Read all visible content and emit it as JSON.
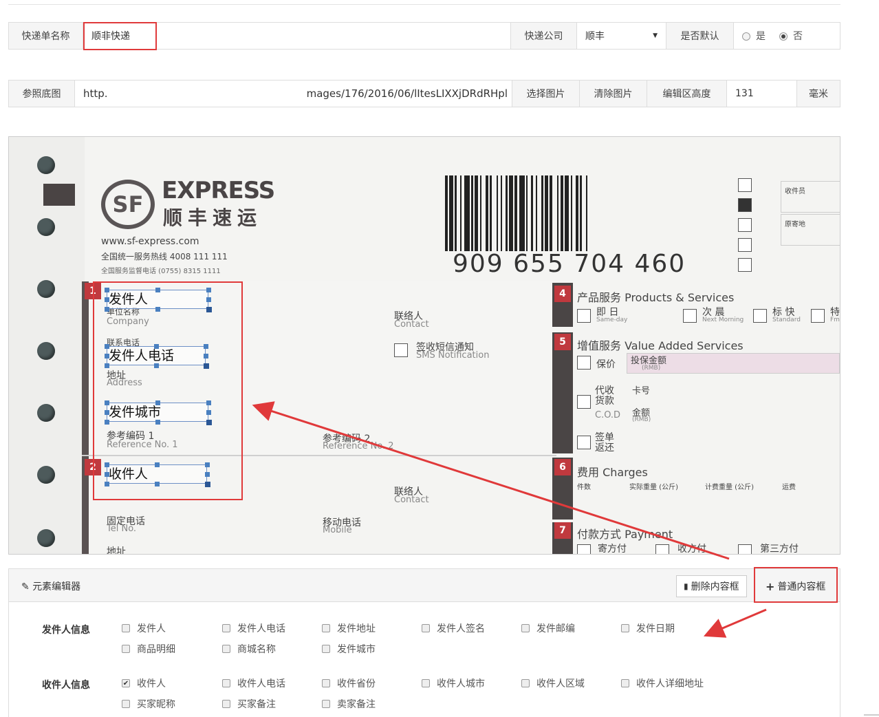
{
  "form": {
    "name_label": "快递单名称",
    "name_value": "顺非快递",
    "company_label": "快递公司",
    "company_value": "顺丰",
    "default_label": "是否默认",
    "default_yes": "是",
    "default_no": "否",
    "default_selected": "否",
    "image_label": "参照底图",
    "image_url_start": "http.",
    "image_url_end": "mages/176/2016/06/lItesLIXXjDRdRHpl",
    "choose_image": "选择图片",
    "clear_image": "清除图片",
    "height_label": "编辑区高度",
    "height_value": "131",
    "height_unit": "毫米"
  },
  "waybill": {
    "logo_mark": "SF",
    "logo_en": "EXPRESS",
    "logo_cn": "顺丰速运",
    "website": "www.sf-express.com",
    "hotline": "全国统一服务热线  4008 111 111",
    "supervise": "全国服务监督电话 (0755) 8315 1111",
    "tracking_number": "909  655  704  460",
    "receiver_staff": "收件员",
    "origin": "原寄地",
    "s1_num": "1",
    "company_cn": "单位名称",
    "company_en": "Company",
    "contact_cn": "联络人",
    "contact_en": "Contact",
    "phone_cn": "联系电话",
    "sms_cn": "签收短信通知",
    "sms_en": "SMS Notification",
    "address_cn": "地址",
    "address_en": "Address",
    "ref1_cn": "参考编码 1",
    "ref1_en": "Reference No. 1",
    "ref2_cn": "参考编码 2",
    "ref2_en": "Reference No. 2",
    "s2_num": "2",
    "tel_cn": "固定电话",
    "tel_en": "Tel No.",
    "mobile_cn": "移动电话",
    "mobile_en": "Mobile",
    "s4_num": "4",
    "products": "产品服务  Products & Services",
    "sameday_cn": "即 日",
    "sameday_en": "Same-day",
    "nextmorning_cn": "次 晨",
    "nextmorning_en": "Next Morning",
    "standard_cn": "标 快",
    "standard_en": "Standard",
    "special_cn": "特",
    "special_en": "Fm",
    "s5_num": "5",
    "value_added": "增值服务  Value Added Services",
    "insured": "保价",
    "insured_amount": "投保金额",
    "rmb": "(RMB)",
    "cod_cn": "代收\n货款",
    "cod_en": "C.O.D",
    "card_no": "卡号",
    "amount": "金额",
    "sign_return": "签单\n返还",
    "s6_num": "6",
    "charges": "费用  Charges",
    "pieces": "件数",
    "actual_weight": "实际重量 (公斤)",
    "charged_weight": "计费重量 (公斤)",
    "freight": "运费",
    "s7_num": "7",
    "payment": "付款方式  Payment",
    "pay_sender": "寄方付",
    "pay_receiver": "收方付",
    "pay_third": "第三方付"
  },
  "elements": {
    "sender": "发件人",
    "sender_phone": "发件人电话",
    "sender_city": "发件城市",
    "receiver": "收件人"
  },
  "editor": {
    "title": "元素编辑器",
    "delete_button": "删除内容框",
    "add_button": "普通内容框",
    "sender_group": "发件人信息",
    "sender_items": [
      "发件人",
      "发件人电话",
      "发件地址",
      "发件人签名",
      "发件邮编",
      "发件日期",
      "商品明细",
      "商城名称",
      "发件城市"
    ],
    "receiver_group": "收件人信息",
    "receiver_items": [
      "收件人",
      "收件人电话",
      "收件省份",
      "收件人城市",
      "收件人区域",
      "收件人详细地址",
      "买家昵称",
      "买家备注",
      "卖家备注"
    ],
    "receiver_checked": [
      "收件人"
    ]
  },
  "colors": {
    "highlight": "#e0393a",
    "handle": "#4a80c0",
    "sf_red": "#c0393e"
  }
}
